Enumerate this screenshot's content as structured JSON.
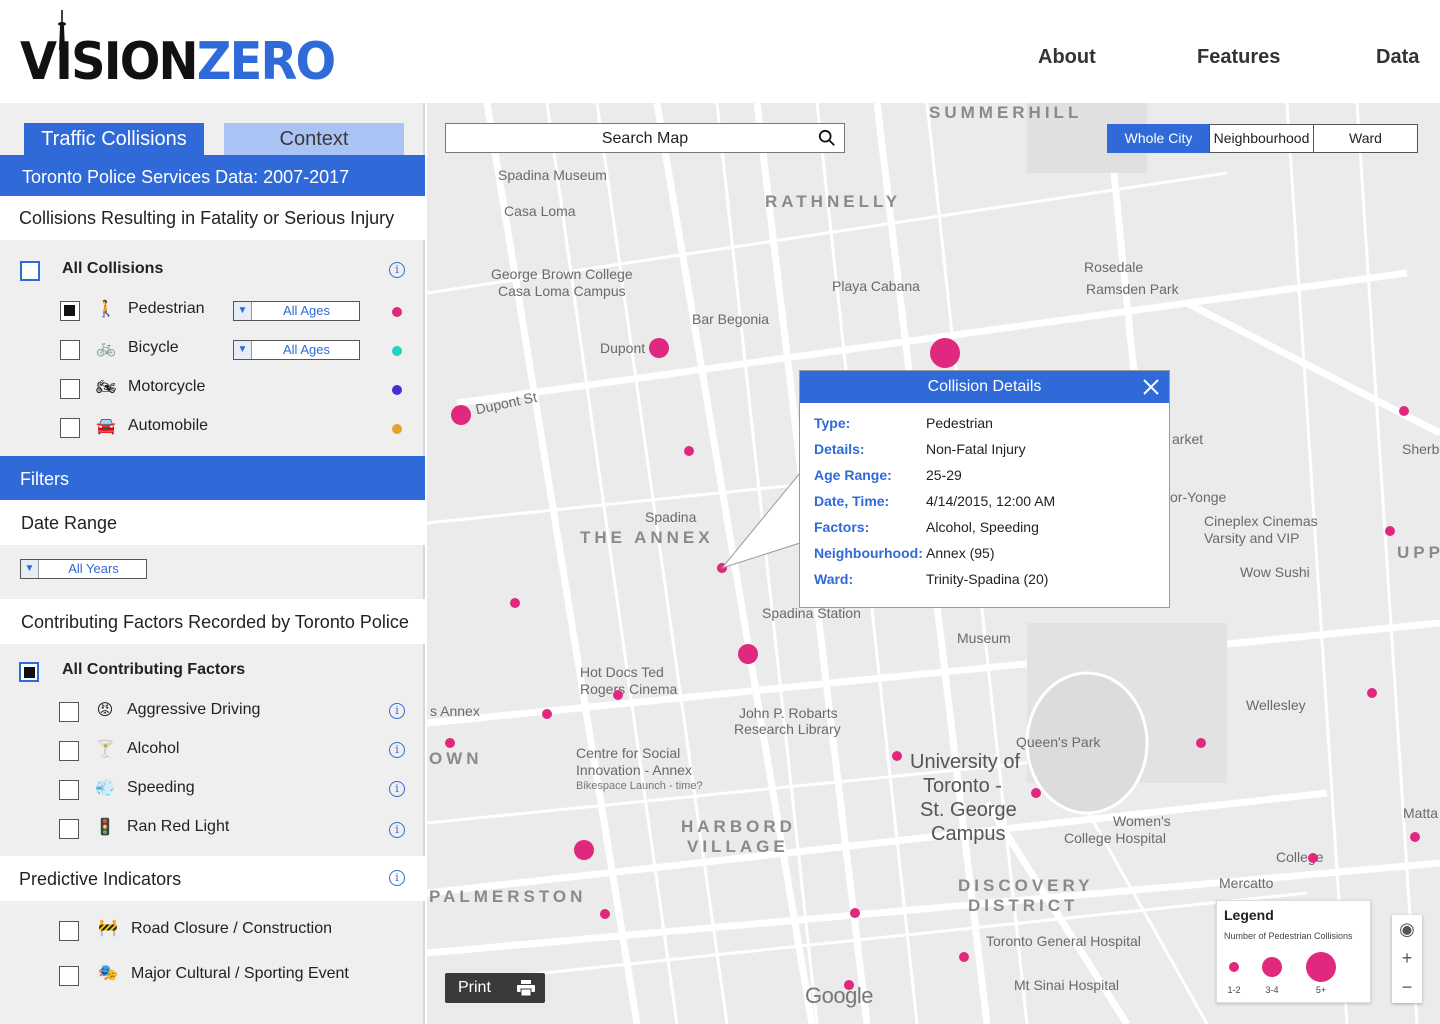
{
  "brand": {
    "vision": "VISION",
    "zero": "ZERO"
  },
  "nav": {
    "about": "About",
    "features": "Features",
    "data": "Data"
  },
  "sidebar": {
    "tabs": {
      "traffic": "Traffic Collisions",
      "context": "Context"
    },
    "source_title": "Toronto Police Services Data: 2007-2017",
    "collisions_title": "Collisions Resulting in Fatality or Serious Injury",
    "all_collisions": "All Collisions",
    "types": [
      {
        "label": "Pedestrian",
        "icon": "pedestrian-icon",
        "glyph": "🚶",
        "checked": true,
        "age": "All Ages",
        "color": "#e0287f"
      },
      {
        "label": "Bicycle",
        "icon": "bicycle-icon",
        "glyph": "🚲",
        "checked": false,
        "age": "All Ages",
        "color": "#22d3c5"
      },
      {
        "label": "Motorcycle",
        "icon": "motorcycle-icon",
        "glyph": "🏍",
        "checked": false,
        "color": "#4a2bd6"
      },
      {
        "label": "Automobile",
        "icon": "car-icon",
        "glyph": "🚘",
        "checked": false,
        "color": "#e8a029"
      }
    ],
    "filters_title": "Filters",
    "date_range_title": "Date Range",
    "date_value": "All Years",
    "factors_title": "Contributing Factors Recorded by Toronto Police",
    "all_factors": "All Contributing Factors",
    "factors": [
      {
        "label": "Aggressive Driving",
        "icon": "angry-face-icon",
        "glyph": "😡"
      },
      {
        "label": "Alcohol",
        "icon": "cocktail-icon",
        "glyph": "🍸"
      },
      {
        "label": "Speeding",
        "icon": "speed-icon",
        "glyph": "💨"
      },
      {
        "label": "Ran Red Light",
        "icon": "traffic-light-icon",
        "glyph": "🚦"
      }
    ],
    "predictive_title": "Predictive Indicators",
    "predictive": [
      {
        "label": "Road Closure /  Construction",
        "icon": "construction-icon",
        "glyph": "🚧"
      },
      {
        "label": "Major Cultural / Sporting Event",
        "icon": "theater-masks-icon",
        "glyph": "🎭"
      }
    ]
  },
  "map": {
    "search_placeholder": "Search Map",
    "scopes": {
      "city": "Whole City",
      "neighbourhood": "Neighbourhood",
      "ward": "Ward"
    },
    "labels": {
      "summerhill": "SUMMERHILL",
      "rathnelly": "RATHNELLY",
      "annex": "THE ANNEX",
      "harbord": "HARBORD",
      "village": "VILLAGE",
      "palmerston": "PALMERSTON",
      "discovery": "DISCOVERY",
      "district": "DISTRICT",
      "spadina_museum": "Spadina Museum",
      "casa_loma": "Casa Loma",
      "george_brown": "George Brown College",
      "casa_loma_campus": "Casa Loma Campus",
      "playa": "Playa Cabana",
      "rosedale": "Rosedale",
      "ramsden": "Ramsden Park",
      "bar_begonia": "Bar Begonia",
      "dupont": "Dupont",
      "dupont_st": "Dupont St",
      "spadina": "Spadina",
      "spadina_station": "Spadina Station",
      "museum": "Museum",
      "hot_docs": "Hot Docs Ted",
      "rogers": "Rogers Cinema",
      "robarts": "John P. Robarts",
      "research_lib": "Research Library",
      "csi": "Centre for Social",
      "csi2": "Innovation - Annex",
      "csi3": "Bikespace Launch - time?",
      "uoft1": "University of",
      "uoft2": "Toronto -",
      "uoft3": "St. George",
      "uoft4": "Campus",
      "queens_park": "Queen's Park",
      "womens1": "Women's",
      "womens2": "College Hospital",
      "tgh": "Toronto General Hospital",
      "sinai": "Mt Sinai Hospital",
      "cineplex": "Cineplex Cinemas",
      "varsity": "Varsity and VIP",
      "wow_sushi": "Wow Sushi",
      "wellesley": "Wellesley",
      "college": "College",
      "mercatto": "Mercatto",
      "matta": "Matta",
      "sherb": "Sherb",
      "york": "or-Yonge",
      "arket": "arket",
      "annex_left": "s Annex",
      "own": "OWN",
      "upp": "UPP"
    },
    "popup": {
      "title": "Collision Details",
      "rows": [
        {
          "k": "Type:",
          "v": "Pedestrian"
        },
        {
          "k": "Details:",
          "v": "Non-Fatal Injury"
        },
        {
          "k": "Age Range:",
          "v": "25-29"
        },
        {
          "k": "Date, Time:",
          "v": "4/14/2015, 12:00 AM"
        },
        {
          "k": "Factors:",
          "v": "Alcohol, Speeding"
        },
        {
          "k": "Neighbourhood:",
          "v": "Annex (95)"
        },
        {
          "k": "Ward:",
          "v": "Trinity-Spadina  (20)"
        }
      ]
    },
    "legend": {
      "title": "Legend",
      "subtitle": "Number of Pedestrian Collisions",
      "l1": "1-2",
      "l2": "3-4",
      "l3": "5+"
    },
    "print_label": "Print",
    "google": "Google",
    "collision_color": "#e0287f",
    "collisions": [
      {
        "lat_class": "a",
        "size": "large"
      }
    ]
  },
  "colors": {
    "accent": "#2f6ad8",
    "accent_light": "#a9c3f5",
    "collision": "#e0287f"
  }
}
